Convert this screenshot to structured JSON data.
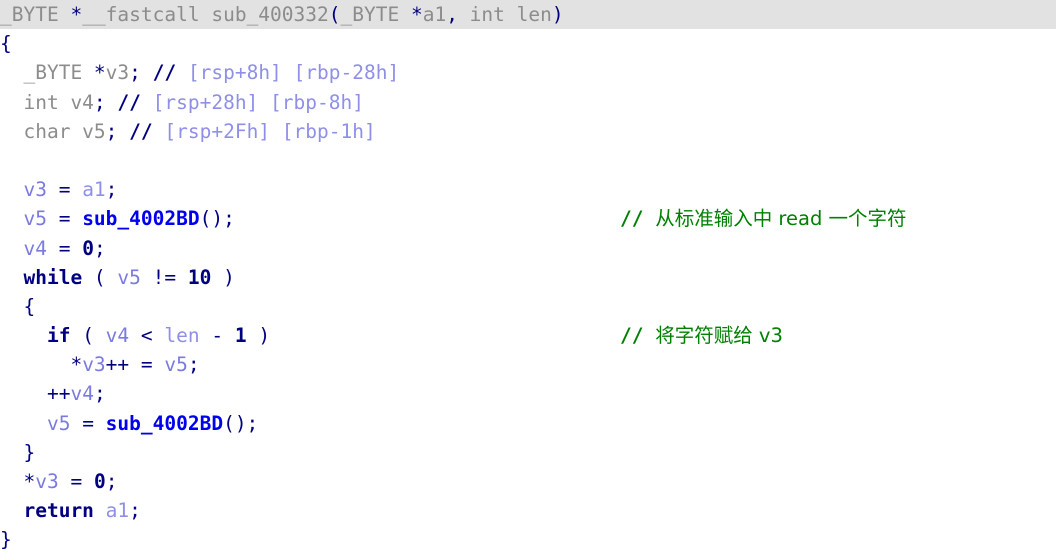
{
  "view": {
    "name": "pseudocode-view",
    "background": "#ffffff",
    "highlight_background": "#e2e2e2",
    "colors": {
      "punctuation": "#000080",
      "type": "#8c8c8c",
      "keyword": "#000080",
      "local_variable": "#7a7ae0",
      "argument": "#8f8fe8",
      "called_function": "#0000ee",
      "number": "#000080",
      "stack_comment": "#8f8fe8",
      "user_comment": "#008000"
    }
  },
  "function": {
    "return_type": "_BYTE *",
    "calling_convention": "__fastcall",
    "name": "sub_400332",
    "parameters": [
      "_BYTE *a1",
      "int len"
    ]
  },
  "lines": [
    {
      "id": "line-signature",
      "highlighted": true,
      "tokens": [
        {
          "cls": "t-type",
          "text": "_BYTE "
        },
        {
          "cls": "t-plain",
          "text": "*"
        },
        {
          "cls": "t-type",
          "text": "__fastcall "
        },
        {
          "cls": "t-type",
          "text": "sub_400332"
        },
        {
          "cls": "t-plain",
          "text": "("
        },
        {
          "cls": "t-type",
          "text": "_BYTE "
        },
        {
          "cls": "t-plain",
          "text": "*"
        },
        {
          "cls": "t-type",
          "text": "a1"
        },
        {
          "cls": "t-plain",
          "text": ", "
        },
        {
          "cls": "t-type",
          "text": "int len"
        },
        {
          "cls": "t-plain",
          "text": ")"
        }
      ],
      "comment": null
    },
    {
      "id": "line-open-brace",
      "highlighted": false,
      "tokens": [
        {
          "cls": "t-plain",
          "text": "{"
        }
      ],
      "comment": null
    },
    {
      "id": "line-decl-v3",
      "highlighted": false,
      "tokens": [
        {
          "cls": "t-type",
          "text": "  _BYTE "
        },
        {
          "cls": "t-plain",
          "text": "*"
        },
        {
          "cls": "t-type",
          "text": "v3"
        },
        {
          "cls": "t-plain",
          "text": "; "
        },
        {
          "cls": "t-cmt-slash",
          "text": "// "
        },
        {
          "cls": "t-stkcmt",
          "text": "[rsp+8h] [rbp-28h]"
        }
      ],
      "comment": null
    },
    {
      "id": "line-decl-v4",
      "highlighted": false,
      "tokens": [
        {
          "cls": "t-type",
          "text": "  int v4"
        },
        {
          "cls": "t-plain",
          "text": "; "
        },
        {
          "cls": "t-cmt-slash",
          "text": "// "
        },
        {
          "cls": "t-stkcmt",
          "text": "[rsp+28h] [rbp-8h]"
        }
      ],
      "comment": null
    },
    {
      "id": "line-decl-v5",
      "highlighted": false,
      "tokens": [
        {
          "cls": "t-type",
          "text": "  char v5"
        },
        {
          "cls": "t-plain",
          "text": "; "
        },
        {
          "cls": "t-cmt-slash",
          "text": "// "
        },
        {
          "cls": "t-stkcmt",
          "text": "[rsp+2Fh] [rbp-1h]"
        }
      ],
      "comment": null
    },
    {
      "id": "line-blank-1",
      "highlighted": false,
      "tokens": [],
      "comment": null
    },
    {
      "id": "line-assign-v3",
      "highlighted": false,
      "tokens": [
        {
          "cls": "t-var",
          "text": "  v3 "
        },
        {
          "cls": "t-plain",
          "text": "= "
        },
        {
          "cls": "t-arg",
          "text": "a1"
        },
        {
          "cls": "t-plain",
          "text": ";"
        }
      ],
      "comment": null
    },
    {
      "id": "line-assign-v5-call",
      "highlighted": false,
      "tokens": [
        {
          "cls": "t-var",
          "text": "  v5 "
        },
        {
          "cls": "t-plain",
          "text": "= "
        },
        {
          "cls": "t-func",
          "text": "sub_4002BD"
        },
        {
          "cls": "t-plain",
          "text": "();"
        }
      ],
      "comment": {
        "slashes": "// ",
        "text": "从标准输入中 read 一个字符"
      }
    },
    {
      "id": "line-assign-v4-zero",
      "highlighted": false,
      "tokens": [
        {
          "cls": "t-var",
          "text": "  v4 "
        },
        {
          "cls": "t-plain",
          "text": "= "
        },
        {
          "cls": "t-num",
          "text": "0"
        },
        {
          "cls": "t-plain",
          "text": ";"
        }
      ],
      "comment": null
    },
    {
      "id": "line-while",
      "highlighted": false,
      "tokens": [
        {
          "cls": "t-kw",
          "text": "  while "
        },
        {
          "cls": "t-plain",
          "text": "( "
        },
        {
          "cls": "t-var",
          "text": "v5 "
        },
        {
          "cls": "t-plain",
          "text": "!= "
        },
        {
          "cls": "t-num",
          "text": "10"
        },
        {
          "cls": "t-plain",
          "text": " )"
        }
      ],
      "comment": null
    },
    {
      "id": "line-while-open-brace",
      "highlighted": false,
      "tokens": [
        {
          "cls": "t-plain",
          "text": "  {"
        }
      ],
      "comment": null
    },
    {
      "id": "line-if",
      "highlighted": false,
      "tokens": [
        {
          "cls": "t-kw",
          "text": "    if "
        },
        {
          "cls": "t-plain",
          "text": "( "
        },
        {
          "cls": "t-var",
          "text": "v4 "
        },
        {
          "cls": "t-plain",
          "text": "< "
        },
        {
          "cls": "t-arg",
          "text": "len "
        },
        {
          "cls": "t-plain",
          "text": "- "
        },
        {
          "cls": "t-num",
          "text": "1"
        },
        {
          "cls": "t-plain",
          "text": " )"
        }
      ],
      "comment": {
        "slashes": "// ",
        "text": "将字符赋给 v3"
      }
    },
    {
      "id": "line-store-char",
      "highlighted": false,
      "tokens": [
        {
          "cls": "t-plain",
          "text": "      *"
        },
        {
          "cls": "t-var",
          "text": "v3"
        },
        {
          "cls": "t-plain",
          "text": "++ = "
        },
        {
          "cls": "t-var",
          "text": "v5"
        },
        {
          "cls": "t-plain",
          "text": ";"
        }
      ],
      "comment": null
    },
    {
      "id": "line-inc-v4",
      "highlighted": false,
      "tokens": [
        {
          "cls": "t-plain",
          "text": "    ++"
        },
        {
          "cls": "t-var",
          "text": "v4"
        },
        {
          "cls": "t-plain",
          "text": ";"
        }
      ],
      "comment": null
    },
    {
      "id": "line-read-next",
      "highlighted": false,
      "tokens": [
        {
          "cls": "t-var",
          "text": "    v5 "
        },
        {
          "cls": "t-plain",
          "text": "= "
        },
        {
          "cls": "t-func",
          "text": "sub_4002BD"
        },
        {
          "cls": "t-plain",
          "text": "();"
        }
      ],
      "comment": null
    },
    {
      "id": "line-while-close-brace",
      "highlighted": false,
      "tokens": [
        {
          "cls": "t-plain",
          "text": "  }"
        }
      ],
      "comment": null
    },
    {
      "id": "line-terminate",
      "highlighted": false,
      "tokens": [
        {
          "cls": "t-plain",
          "text": "  *"
        },
        {
          "cls": "t-var",
          "text": "v3 "
        },
        {
          "cls": "t-plain",
          "text": "= "
        },
        {
          "cls": "t-num",
          "text": "0"
        },
        {
          "cls": "t-plain",
          "text": ";"
        }
      ],
      "comment": null
    },
    {
      "id": "line-return",
      "highlighted": false,
      "tokens": [
        {
          "cls": "t-kw",
          "text": "  return "
        },
        {
          "cls": "t-arg",
          "text": "a1"
        },
        {
          "cls": "t-plain",
          "text": ";"
        }
      ],
      "comment": null
    },
    {
      "id": "line-close-brace",
      "highlighted": false,
      "tokens": [
        {
          "cls": "t-plain",
          "text": "}"
        }
      ],
      "comment": null
    }
  ]
}
